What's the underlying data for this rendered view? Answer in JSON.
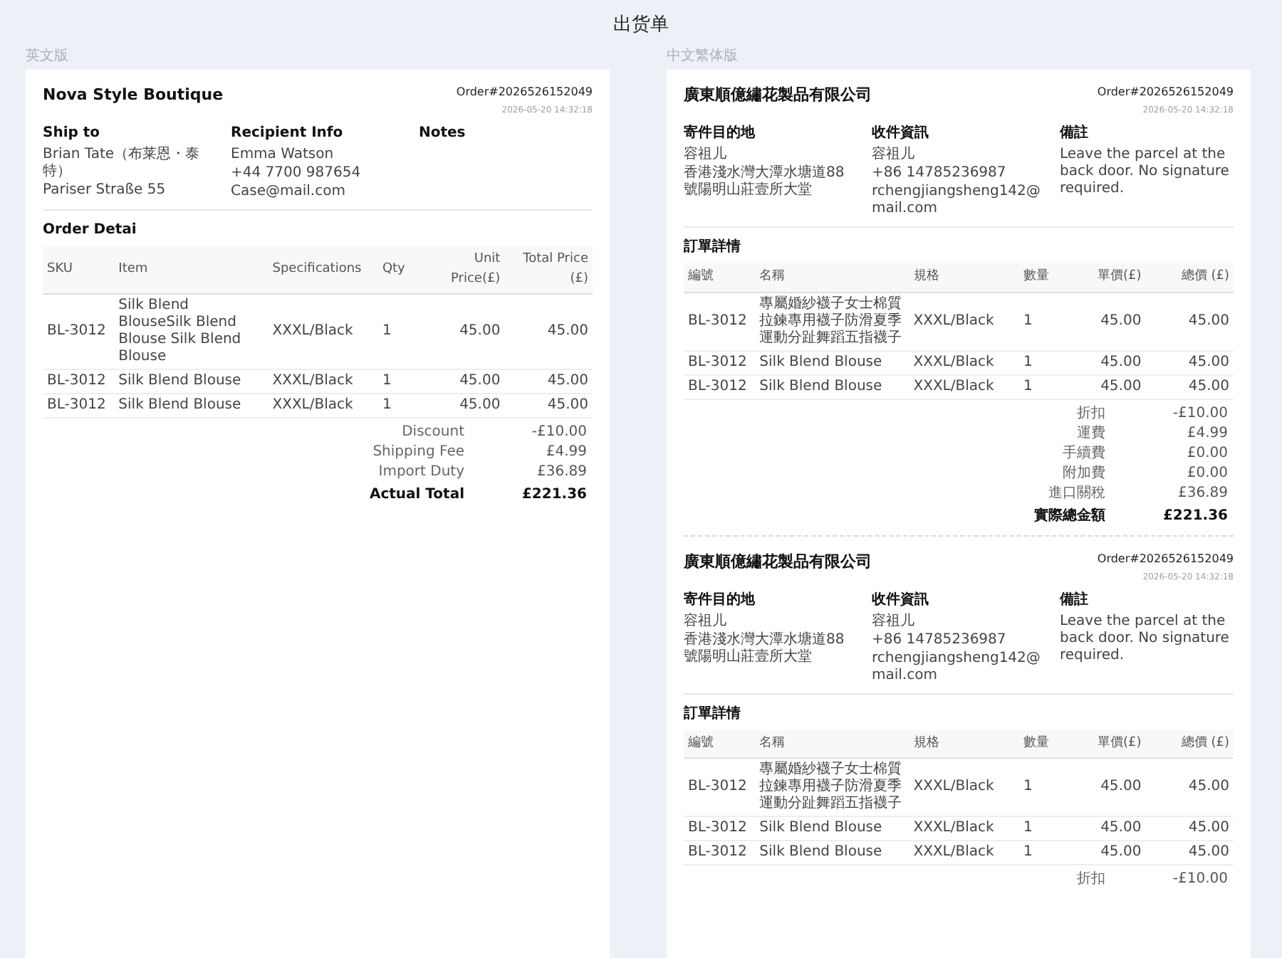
{
  "title": "出货单",
  "panels": [
    {
      "label": "英文版",
      "invoices": [
        {
          "company": "Nova Style Boutique",
          "order_no": "Order#2026526152049",
          "datetime": "2026-05-20 14:32:18",
          "sections": [
            {
              "heading": "Ship to",
              "lines": [
                "Brian Tate（布莱恩・泰特）",
                "Pariser Straße 55"
              ]
            },
            {
              "heading": "Recipient Info",
              "lines": [
                "Emma Watson",
                "+44 7700 987654",
                "Case@mail.com"
              ]
            },
            {
              "heading": "Notes"
            }
          ],
          "detail_heading": "Order Detai",
          "columns": [
            "SKU",
            "Item",
            "Specifications",
            "Qty",
            "Unit Price(£)",
            "Total Price (£)"
          ],
          "rows": [
            [
              "BL-3012",
              "Silk Blend BlouseSilk Blend Blouse Silk Blend Blouse",
              "XXXL/Black",
              "1",
              "45.00",
              "45.00"
            ],
            [
              "BL-3012",
              "Silk Blend Blouse",
              "XXXL/Black",
              "1",
              "45.00",
              "45.00"
            ],
            [
              "BL-3012",
              "Silk Blend Blouse",
              "XXXL/Black",
              "1",
              "45.00",
              "45.00"
            ]
          ],
          "totals": [
            {
              "label": "Discount",
              "value": "-£10.00",
              "kind": "line"
            },
            {
              "label": "Shipping Fee",
              "value": "£4.99",
              "kind": "line"
            },
            {
              "label": "Import Duty",
              "value": "£36.89",
              "kind": "line"
            },
            {
              "label": "Actual Total",
              "value": "£221.36",
              "kind": "grand"
            }
          ]
        }
      ]
    },
    {
      "label": "中文繁体版",
      "invoices": [
        {
          "company": "廣東順億繡花製品有限公司",
          "order_no": "Order#2026526152049",
          "datetime": "2026-05-20 14:32:18",
          "sections": [
            {
              "heading": "寄件目的地",
              "lines": [
                "容祖儿",
                "香港淺水灣大潭水塘道88號陽明山莊壹所大堂"
              ]
            },
            {
              "heading": "收件資訊",
              "lines": [
                "容祖儿",
                "+86 14785236987",
                "rchengjiangsheng142@mail.com"
              ]
            },
            {
              "heading": "備註",
              "lines": [
                "Leave the parcel at the back door. No signature required."
              ]
            }
          ],
          "detail_heading": "訂單詳情",
          "columns": [
            "編號",
            "名稱",
            "規格",
            "數量",
            "單價(£)",
            "總價 (£)"
          ],
          "rows": [
            [
              "BL-3012",
              "專屬婚紗襪子女士棉質拉鍊專用襪子防滑夏季運動分趾舞蹈五指襪子",
              "XXXL/Black",
              "1",
              "45.00",
              "45.00"
            ],
            [
              "BL-3012",
              "Silk Blend Blouse",
              "XXXL/Black",
              "1",
              "45.00",
              "45.00"
            ],
            [
              "BL-3012",
              "Silk Blend Blouse",
              "XXXL/Black",
              "1",
              "45.00",
              "45.00"
            ]
          ],
          "totals": [
            {
              "label": "折扣",
              "value": "-£10.00",
              "kind": "line"
            },
            {
              "label": "運費",
              "value": "£4.99",
              "kind": "line"
            },
            {
              "label": "手續費",
              "value": "£0.00",
              "kind": "line"
            },
            {
              "label": "附加費",
              "value": "£0.00",
              "kind": "line"
            },
            {
              "label": "進口關稅",
              "value": "£36.89",
              "kind": "line"
            },
            {
              "label": "實際總金額",
              "value": "£221.36",
              "kind": "grand"
            }
          ]
        },
        {
          "company": "廣東順億繡花製品有限公司",
          "order_no": "Order#2026526152049",
          "datetime": "2026-05-20 14:32:18",
          "sections": [
            {
              "heading": "寄件目的地",
              "lines": [
                "容祖儿",
                "香港淺水灣大潭水塘道88號陽明山莊壹所大堂"
              ]
            },
            {
              "heading": "收件資訊",
              "lines": [
                "容祖儿",
                "+86 14785236987",
                "rchengjiangsheng142@mail.com"
              ]
            },
            {
              "heading": "備註",
              "lines": [
                "Leave the parcel at the back door. No signature required."
              ]
            }
          ],
          "detail_heading": "訂單詳情",
          "columns": [
            "編號",
            "名稱",
            "規格",
            "數量",
            "單價(£)",
            "總價 (£)"
          ],
          "rows": [
            [
              "BL-3012",
              "專屬婚紗襪子女士棉質拉鍊專用襪子防滑夏季運動分趾舞蹈五指襪子",
              "XXXL/Black",
              "1",
              "45.00",
              "45.00"
            ],
            [
              "BL-3012",
              "Silk Blend Blouse",
              "XXXL/Black",
              "1",
              "45.00",
              "45.00"
            ],
            [
              "BL-3012",
              "Silk Blend Blouse",
              "XXXL/Black",
              "1",
              "45.00",
              "45.00"
            ]
          ],
          "totals": [
            {
              "label": "折扣",
              "value": "-£10.00",
              "kind": "line"
            }
          ]
        }
      ]
    }
  ]
}
